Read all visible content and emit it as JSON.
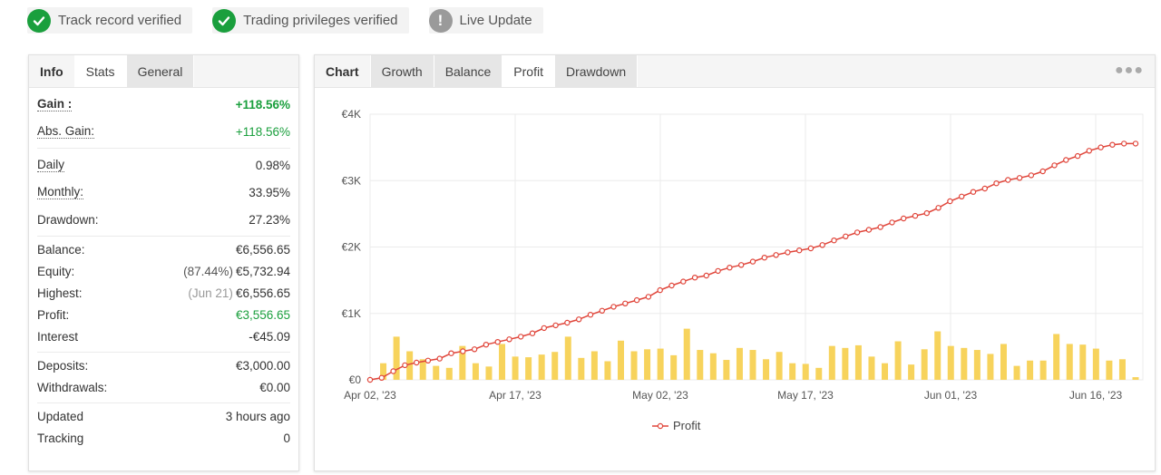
{
  "badges": [
    {
      "label": "Track record verified",
      "icon": "check-circle-icon"
    },
    {
      "label": "Trading privileges verified",
      "icon": "check-circle-icon"
    },
    {
      "label": "Live Update",
      "icon": "exclamation-circle-icon"
    }
  ],
  "left_tabs": [
    "Info",
    "Stats",
    "General"
  ],
  "stats": {
    "gain": {
      "label": "Gain :",
      "value": "+118.56%"
    },
    "abs_gain": {
      "label": "Abs. Gain:",
      "value": "+118.56%"
    },
    "daily": {
      "label": "Daily",
      "value": "0.98%"
    },
    "monthly": {
      "label": "Monthly:",
      "value": "33.95%"
    },
    "drawdown": {
      "label": "Drawdown:",
      "value": "27.23%"
    },
    "balance": {
      "label": "Balance:",
      "value": "€6,556.65"
    },
    "equity": {
      "label": "Equity:",
      "note": "(87.44%)",
      "value": "€5,732.94"
    },
    "highest": {
      "label": "Highest:",
      "note": "(Jun 21)",
      "value": "€6,556.65"
    },
    "profit": {
      "label": "Profit:",
      "value": "€3,556.65"
    },
    "interest": {
      "label": "Interest",
      "value": "-€45.09"
    },
    "deposits": {
      "label": "Deposits:",
      "value": "€3,000.00"
    },
    "withdrawals": {
      "label": "Withdrawals:",
      "value": "€0.00"
    },
    "updated": {
      "label": "Updated",
      "value": "3 hours ago"
    },
    "tracking": {
      "label": "Tracking",
      "value": "0"
    }
  },
  "right_tabs": [
    "Chart",
    "Growth",
    "Balance",
    "Profit",
    "Drawdown"
  ],
  "more_icon": "more-dots-icon",
  "colors": {
    "green": "#1a9f3d",
    "line": "#e0453a",
    "bar": "#f7d35c"
  },
  "chart_data": {
    "type": "line",
    "x_tick_labels": [
      "Apr 02, '23",
      "Apr 17, '23",
      "May 02, '23",
      "May 17, '23",
      "Jun 01, '23",
      "Jun 16, '23"
    ],
    "y_tick_labels": [
      "€0",
      "€1K",
      "€2K",
      "€3K",
      "€4K"
    ],
    "ylim": [
      0,
      4000
    ],
    "x_range": [
      "2023-04-02",
      "2023-06-21"
    ],
    "legend": [
      "Profit"
    ],
    "legend_position": "bottom-center",
    "grid": true,
    "series": [
      {
        "name": "Profit",
        "type": "line",
        "values": [
          0,
          30,
          130,
          220,
          260,
          290,
          320,
          400,
          430,
          460,
          530,
          570,
          610,
          650,
          700,
          780,
          820,
          860,
          910,
          980,
          1040,
          1100,
          1150,
          1200,
          1250,
          1350,
          1420,
          1480,
          1540,
          1570,
          1640,
          1690,
          1730,
          1780,
          1840,
          1880,
          1920,
          1950,
          1980,
          2030,
          2100,
          2160,
          2220,
          2260,
          2300,
          2370,
          2430,
          2470,
          2510,
          2590,
          2690,
          2760,
          2830,
          2880,
          2960,
          3010,
          3040,
          3080,
          3140,
          3230,
          3310,
          3370,
          3450,
          3500,
          3540,
          3557,
          3557
        ]
      },
      {
        "type": "bar",
        "values": [
          0,
          250,
          650,
          430,
          310,
          210,
          180,
          510,
          250,
          200,
          540,
          350,
          340,
          380,
          420,
          650,
          330,
          430,
          280,
          590,
          430,
          460,
          470,
          370,
          770,
          450,
          400,
          300,
          480,
          450,
          310,
          420,
          250,
          240,
          180,
          510,
          480,
          520,
          350,
          250,
          580,
          230,
          460,
          730,
          510,
          480,
          450,
          390,
          540,
          210,
          290,
          290,
          690,
          540,
          530,
          470,
          290,
          310,
          40
        ]
      }
    ]
  }
}
